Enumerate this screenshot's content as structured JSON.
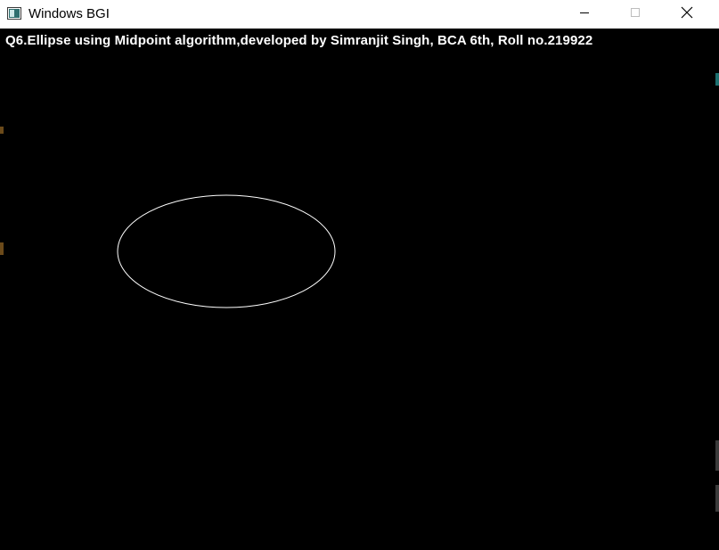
{
  "window": {
    "title": "Windows BGI",
    "icon": "bgi-window-icon",
    "controls": {
      "minimize_icon": "minimize-icon",
      "maximize_icon": "maximize-icon",
      "close_icon": "close-icon"
    }
  },
  "canvas": {
    "background": "#000000",
    "heading": "Q6.Ellipse using Midpoint algorithm,developed by Simranjit Singh, BCA 6th, Roll no.219922",
    "text_color": "#ffffff",
    "ellipse_color": "#ffffff"
  }
}
